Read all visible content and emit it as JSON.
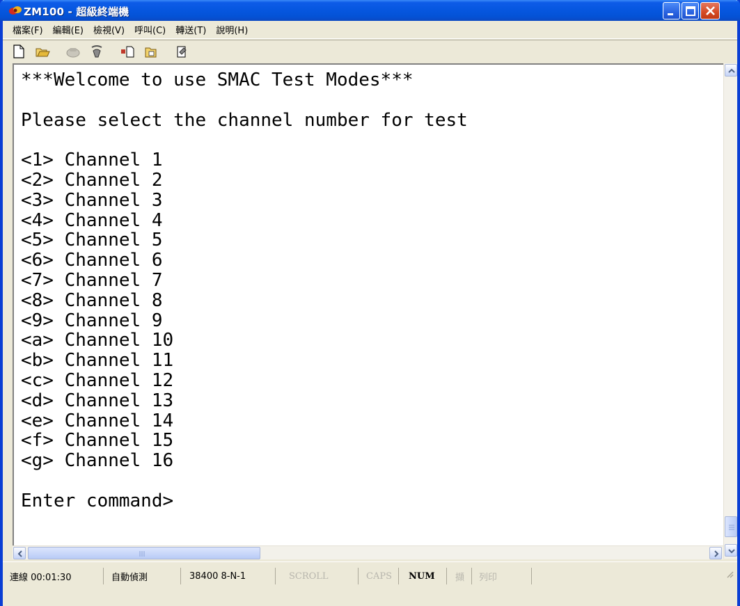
{
  "window": {
    "title": "ZM100 - 超級終端機"
  },
  "menu": {
    "items": [
      "檔案(F)",
      "編輯(E)",
      "檢視(V)",
      "呼叫(C)",
      "轉送(T)",
      "說明(H)"
    ]
  },
  "toolbar": {
    "icons": [
      "new-icon",
      "open-icon",
      "disconnect-icon",
      "dial-icon",
      "send-icon",
      "receive-icon",
      "properties-icon"
    ]
  },
  "terminal": {
    "lines": [
      "***Welcome to use SMAC Test Modes***",
      "",
      "Please select the channel number for test",
      "",
      "<1> Channel 1",
      "<2> Channel 2",
      "<3> Channel 3",
      "<4> Channel 4",
      "<5> Channel 5",
      "<6> Channel 6",
      "<7> Channel 7",
      "<8> Channel 8",
      "<9> Channel 9",
      "<a> Channel 10",
      "<b> Channel 11",
      "<c> Channel 12",
      "<d> Channel 13",
      "<e> Channel 14",
      "<f> Channel 15",
      "<g> Channel 16",
      "",
      "Enter command>"
    ]
  },
  "status": {
    "connected": "連線 00:01:30",
    "detect": "自動偵測",
    "settings": "38400 8-N-1",
    "scroll": "SCROLL",
    "caps": "CAPS",
    "num": "NUM",
    "capture": "擷",
    "print": "列印"
  },
  "colors": {
    "titlebar": "#0657e0",
    "chrome": "#ece9d8"
  }
}
